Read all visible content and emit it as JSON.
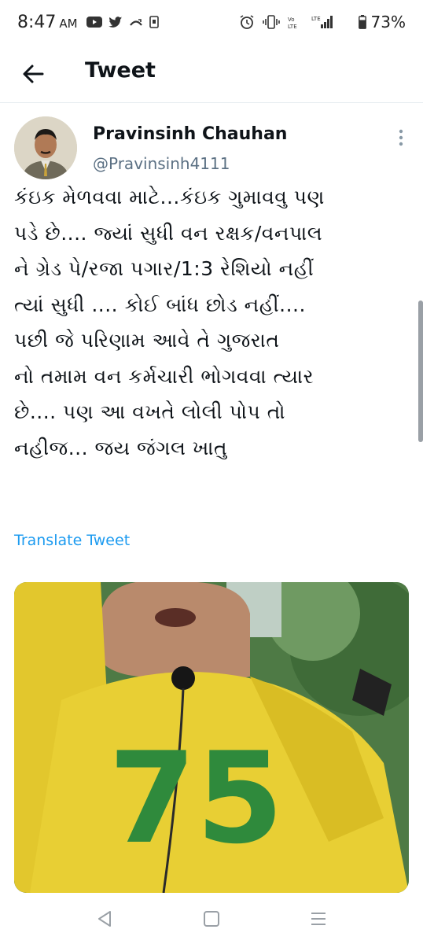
{
  "status_bar": {
    "time": "8:47",
    "ampm": "AM",
    "battery_percent": "73%",
    "left_icons": [
      "youtube-icon",
      "twitter-icon",
      "missed-call-icon",
      "screenshot-icon"
    ],
    "right_icons": [
      "alarm-icon",
      "vibrate-icon",
      "volte-icon",
      "lte-signal-icon",
      "battery-icon"
    ],
    "battery_level": 0.73
  },
  "header": {
    "title": "Tweet"
  },
  "tweet": {
    "author_name": "Pravinsinh Chauhan",
    "author_handle": "@Pravinsinh4111",
    "text_lines": [
      "કંઇક મેળવવા માટે...કંઇક ગુમાવવુ પણ",
      "પડે છે.... જ્યાં સુધી વન રક્ષક/વનપાલ",
      "ને ગ્રેડ પે/રજા પગાર/1:3 રેશિયો નહીં",
      "ત્યાં સુધી .... કોઈ બાંધ છોડ નહીં....",
      "પછી જે પરિણામ આવે તે ગુજરાત",
      "નો તમામ વન કર્મચારી ભોગવવા ત્યાર",
      "છે.... પણ આ વખતે લોલી પોપ તો",
      "નહીજ... જય જંગલ ખાતુ"
    ],
    "translate_label": "Translate Tweet"
  },
  "colors": {
    "link": "#1d9bf0",
    "handle": "#5b7083",
    "text": "#0f1419"
  }
}
